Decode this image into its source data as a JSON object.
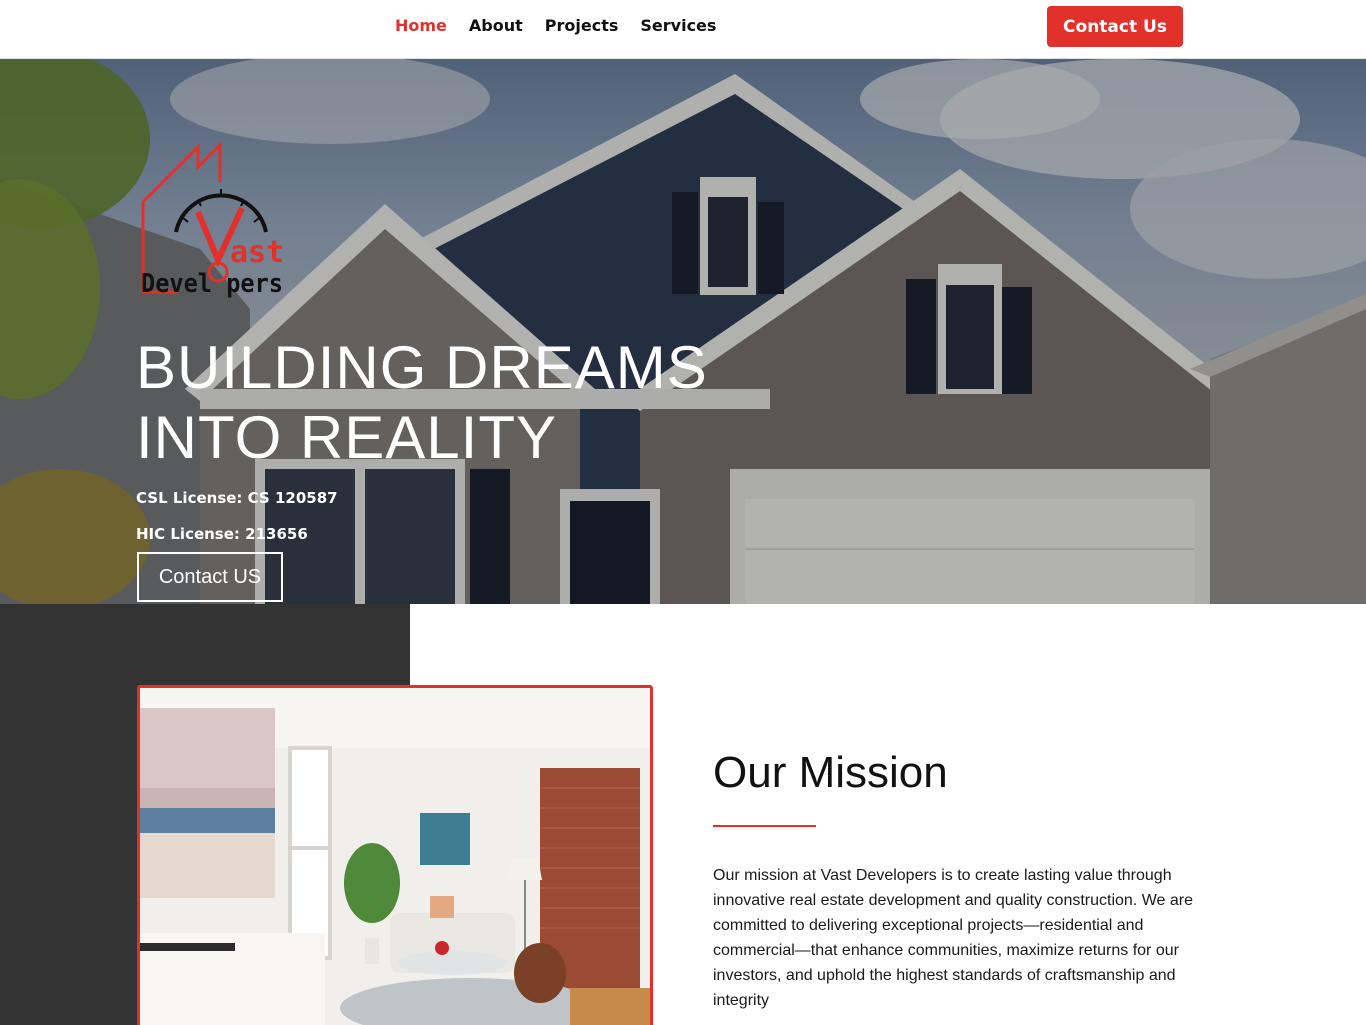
{
  "nav": {
    "links": [
      {
        "label": "Home",
        "active": true
      },
      {
        "label": "About",
        "active": false
      },
      {
        "label": "Projects",
        "active": false
      },
      {
        "label": "Services",
        "active": false
      }
    ],
    "cta_label": "Contact Us"
  },
  "hero": {
    "logo": {
      "line1": "Vast",
      "line2": "Developers",
      "icon": "house-gauge-logo"
    },
    "title_line1": "BUILDING DREAMS",
    "title_line2": "INTO REALITY",
    "license_csl": "CSL License: CS 120587",
    "license_hic": "HIC License: 213656",
    "button_label": "Contact US"
  },
  "mission": {
    "title": "Our Mission",
    "body": "Our mission at Vast Developers is to create lasting value through innovative real estate development and quality construction. We are committed to delivering exceptional projects—residential and commercial—that enhance communities, maximize returns for our investors, and uphold the highest standards of craftsmanship and integrity"
  },
  "colors": {
    "accent": "#e2302b",
    "dark_block": "#333333",
    "text": "#111111"
  }
}
